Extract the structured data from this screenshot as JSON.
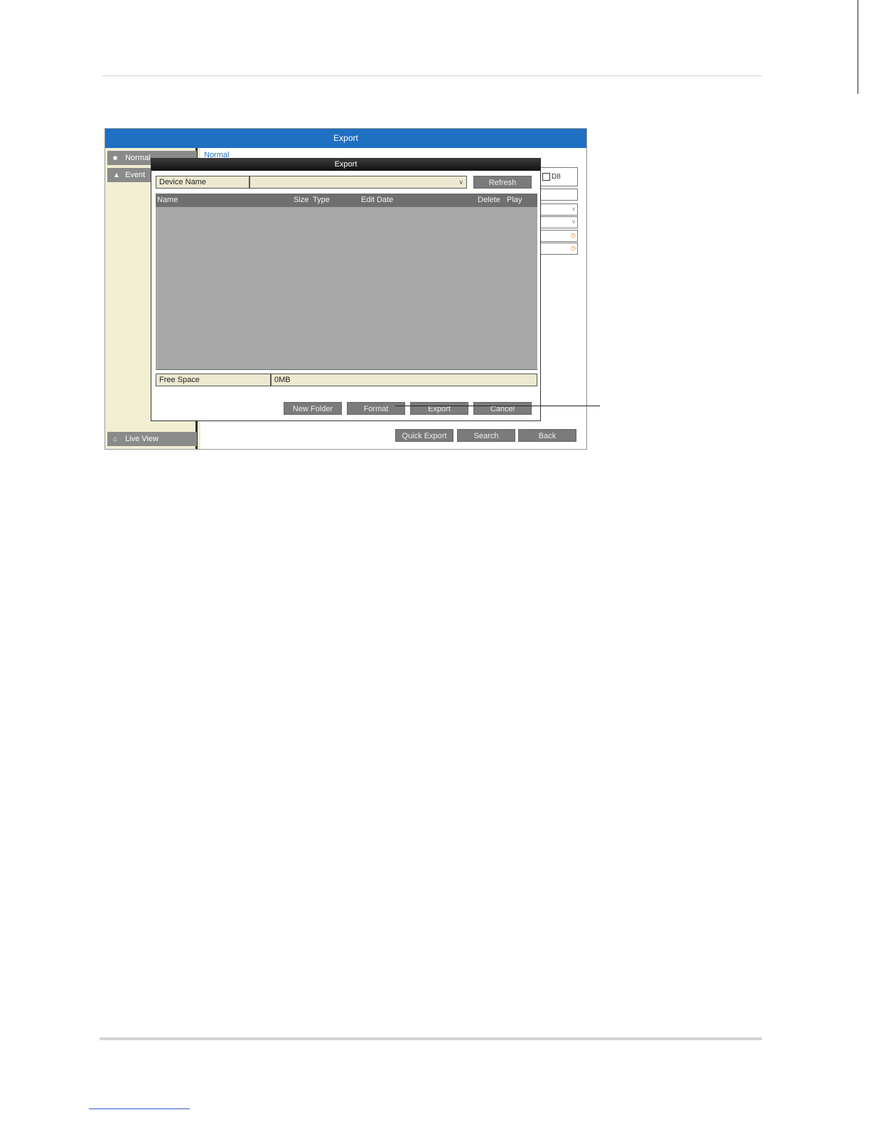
{
  "window": {
    "title": "Export",
    "sidebar": {
      "items": [
        {
          "label": "Normal",
          "icon": "folder-icon"
        },
        {
          "label": "Event",
          "icon": "event-icon"
        }
      ],
      "live_view": {
        "label": "Live View",
        "icon": "home-icon"
      }
    },
    "sub_tab": "Normal",
    "channel_label": "D8",
    "buttons": {
      "quick_export": "Quick Export",
      "search": "Search",
      "back": "Back"
    }
  },
  "dialog": {
    "title": "Export",
    "device_name_label": "Device Name",
    "device_name_value": "",
    "refresh_label": "Refresh",
    "columns": [
      "Name",
      "Size",
      "Type",
      "Edit Date",
      "Delete",
      "Play"
    ],
    "free_space_label": "Free Space",
    "free_space_value": "0MB",
    "buttons": {
      "new_folder": "New Folder",
      "format": "Format",
      "export": "Export",
      "cancel": "Cancel"
    }
  }
}
